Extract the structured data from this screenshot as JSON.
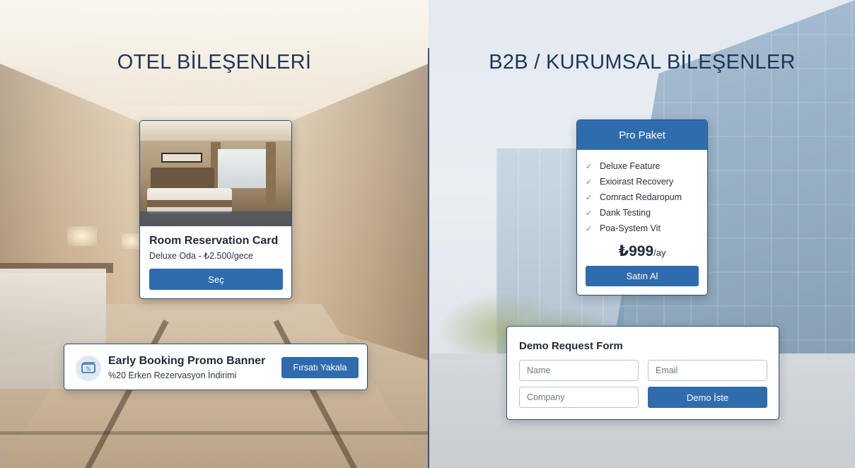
{
  "hotel": {
    "section_title": "OTEL BİLEŞENLERİ",
    "room_card": {
      "title": "Room Reservation Card",
      "subtitle": "Deluxe Oda - ₺2.500/gece",
      "button": "Seç"
    },
    "promo_banner": {
      "title": "Early Booking Promo Banner",
      "subtitle": "%20 Erken Rezervasyon İndirimi",
      "button": "Fırsatı Yakala",
      "icon": "discount-ticket-icon"
    }
  },
  "b2b": {
    "section_title": "B2B / KURUMSAL BİLEŞENLER",
    "pricing_card": {
      "header": "Pro Paket",
      "features": [
        "Deluxe Feature",
        "Exioirast Recovery",
        "Comract Redaropum",
        "Dank Testing",
        "Poa-System Vit"
      ],
      "price": "₺999",
      "price_unit": "/ay",
      "button": "Satın Al"
    },
    "demo_form": {
      "title": "Demo Request Form",
      "name_placeholder": "Name",
      "email_placeholder": "Email",
      "company_placeholder": "Company",
      "button": "Demo İste"
    }
  },
  "colors": {
    "accent": "#2f6cad",
    "border": "#2d4f78",
    "heading": "#1e3657"
  }
}
